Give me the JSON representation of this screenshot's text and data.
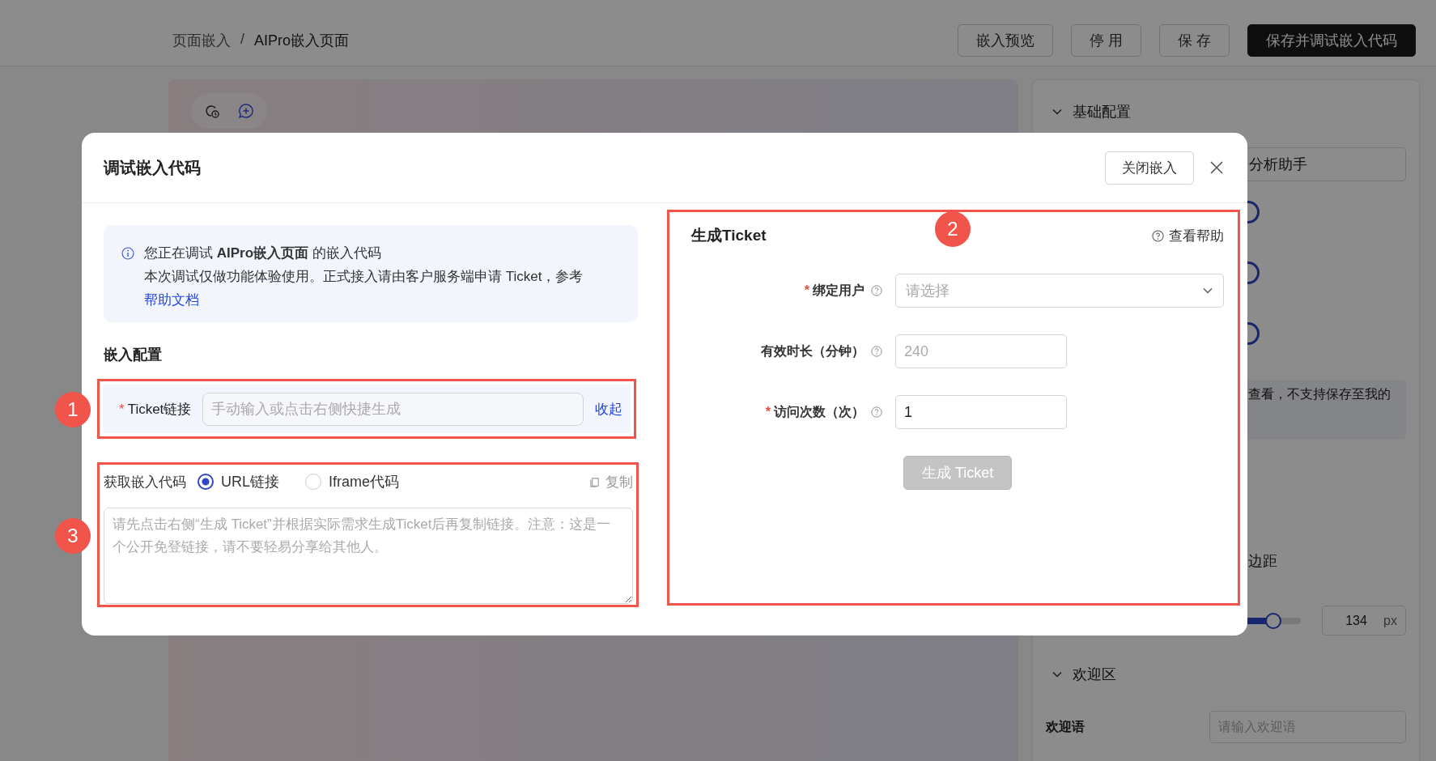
{
  "breadcrumb": {
    "items": [
      {
        "label": "页面嵌入",
        "current": false
      },
      {
        "label": "AIPro嵌入页面",
        "current": true
      }
    ],
    "separator": "/"
  },
  "actions": [
    {
      "label": "嵌入预览",
      "kind": "default"
    },
    {
      "label": "停 用",
      "kind": "default"
    },
    {
      "label": "保 存",
      "kind": "default"
    },
    {
      "label": "保存并调试嵌入代码",
      "kind": "primary"
    }
  ],
  "side_panel": {
    "basic_section": {
      "title": "基础配置",
      "expanded": true
    },
    "assistant_field": {
      "value": "分析助手"
    },
    "notice": "查看，不支持保存至我的",
    "margin_label": "边距",
    "width_slider": {
      "level": 0.89
    },
    "width_value": "134",
    "width_unit": "px",
    "welcome_section": {
      "title": "欢迎区",
      "expanded": true
    },
    "welcome_field": {
      "label": "欢迎语",
      "placeholder": "请输入欢迎语"
    }
  },
  "dialog": {
    "title": "调试嵌入代码",
    "close_embed_button": "关闭嵌入",
    "info": {
      "line1": "您正在调试 **AIPro嵌入页面** 的嵌入代码",
      "line2": "本次调试仅做功能体验使用。正式接入请由客户服务端申请 Ticket，参考",
      "link": "帮助文档"
    },
    "section_title": "嵌入配置",
    "required_mark": "*",
    "ticket_link": {
      "label": "Ticket链接",
      "required": true,
      "placeholder": "手动输入或点击右侧快捷生成",
      "action": "收起"
    },
    "embed_code": {
      "label": "获取嵌入代码",
      "options": [
        {
          "label": "URL链接",
          "selected": true
        },
        {
          "label": "Iframe代码",
          "selected": false
        }
      ],
      "copy": "复制",
      "placeholder": "请先点击右侧“生成 Ticket”并根据实际需求生成Ticket后再复制链接。注意：这是一个公开免登链接，请不要轻易分享给其他人。"
    },
    "generator": {
      "title": "生成Ticket",
      "help": "查看帮助",
      "fields": [
        {
          "label": "绑定用户",
          "required": true,
          "kind": "select",
          "placeholder": "请选择"
        },
        {
          "label": "有效时长（分钟）",
          "required": false,
          "kind": "input",
          "placeholder": "240"
        },
        {
          "label": "访问次数（次）",
          "required": true,
          "kind": "input",
          "value": "1"
        }
      ],
      "submit": {
        "label": "生成 Ticket",
        "disabled": true
      }
    }
  },
  "annotations": [
    {
      "number": "1"
    },
    {
      "number": "2"
    },
    {
      "number": "3"
    }
  ]
}
